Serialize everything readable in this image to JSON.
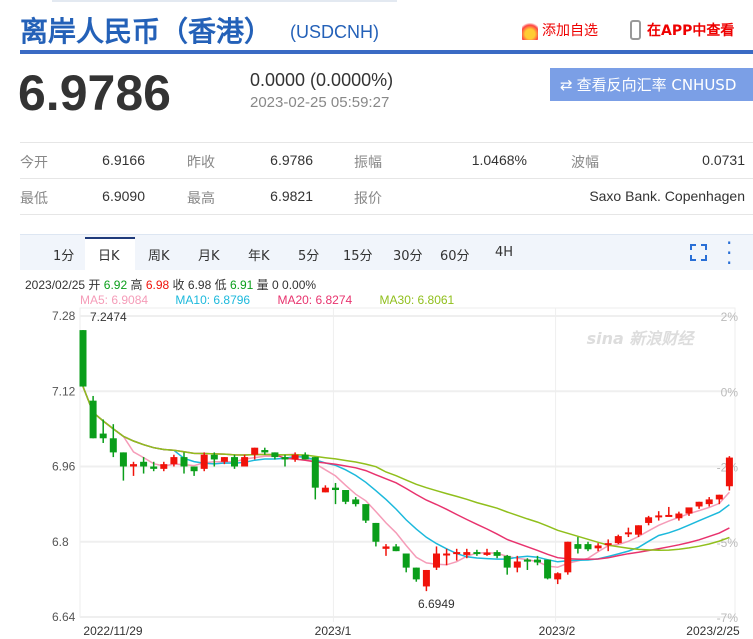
{
  "header": {
    "title": "离岸人民币（香港）",
    "code": "(USDCNH)",
    "add_watch": "添加自选",
    "view_in_app": "在APP中查看"
  },
  "quote": {
    "price": "6.9786",
    "change": "0.0000 (0.0000%)",
    "timestamp": "2023-02-25 05:59:27",
    "reverse_button": "查看反向汇率 CNHUSD"
  },
  "stats": [
    [
      {
        "label": "今开",
        "value": "6.9166"
      },
      {
        "label": "昨收",
        "value": "6.9786"
      },
      {
        "label": "振幅",
        "value": "1.0468%"
      },
      {
        "label": "波幅",
        "value": "0.0731"
      }
    ],
    [
      {
        "label": "最低",
        "value": "6.9090"
      },
      {
        "label": "最高",
        "value": "6.9821"
      },
      {
        "label": "报价",
        "value": ""
      },
      {
        "label": "",
        "value": "Saxo Bank. Copenhagen"
      }
    ]
  ],
  "tabs": [
    "1分",
    "日K",
    "周K",
    "月K",
    "年K",
    "5分",
    "15分",
    "30分",
    "60分",
    "4H"
  ],
  "active_tab": "日K",
  "ohlc_info": {
    "date": "2023/02/25",
    "open_label": "开",
    "open": "6.92",
    "high_label": "高",
    "high": "6.98",
    "close_label": "收",
    "close": "6.98",
    "low_label": "低",
    "low": "6.91",
    "vol_label": "量",
    "vol": "0 0.00%"
  },
  "ma_info": {
    "ma5": "MA5: 6.9084",
    "ma10": "MA10: 6.8796",
    "ma20": "MA20: 6.8274",
    "ma30": "MA30: 6.8061"
  },
  "colors": {
    "up": "#f0120a",
    "down": "#0a9e1a",
    "ma5": "#f59cb8",
    "ma10": "#1cb9dc",
    "ma20": "#e8336e",
    "ma30": "#90bf1c",
    "brand": "#2461b8"
  },
  "chart_data": {
    "type": "candlestick",
    "y_ticks": [
      "7.28",
      "7.12",
      "6.96",
      "6.8",
      "6.64"
    ],
    "y_tick_values": [
      7.28,
      7.12,
      6.96,
      6.8,
      6.64
    ],
    "pct_ticks": [
      "2%",
      "0%",
      "-2%",
      "-5%",
      "-7%"
    ],
    "pct_tick_values": [
      7.28,
      7.12,
      6.96,
      6.8,
      6.64
    ],
    "x_labels": [
      "2022/11/29",
      "2023/1",
      "2023/2",
      "2023/2/25"
    ],
    "x_label_index": [
      3,
      24,
      46,
      62
    ],
    "max_label": "7.2474",
    "min_label": "6.6949",
    "ylim": [
      6.64,
      7.28
    ],
    "ohlc": [
      [
        7.25,
        7.25,
        7.13,
        7.13
      ],
      [
        7.1,
        7.11,
        7.02,
        7.02
      ],
      [
        7.03,
        7.06,
        7.01,
        7.02
      ],
      [
        7.02,
        7.05,
        6.98,
        6.99
      ],
      [
        6.99,
        6.99,
        6.93,
        6.96
      ],
      [
        6.96,
        6.97,
        6.94,
        6.965
      ],
      [
        6.97,
        6.98,
        6.945,
        6.96
      ],
      [
        6.96,
        6.97,
        6.95,
        6.955
      ],
      [
        6.955,
        6.97,
        6.95,
        6.965
      ],
      [
        6.965,
        6.985,
        6.96,
        6.98
      ],
      [
        6.98,
        6.99,
        6.945,
        6.96
      ],
      [
        6.96,
        6.96,
        6.94,
        6.95
      ],
      [
        6.955,
        6.99,
        6.95,
        6.985
      ],
      [
        6.985,
        6.99,
        6.96,
        6.975
      ],
      [
        6.97,
        6.98,
        6.965,
        6.98
      ],
      [
        6.98,
        6.985,
        6.955,
        6.96
      ],
      [
        6.96,
        6.985,
        6.96,
        6.98
      ],
      [
        6.985,
        7.0,
        6.975,
        7.0
      ],
      [
        6.995,
        7.0,
        6.985,
        6.99
      ],
      [
        6.99,
        6.99,
        6.975,
        6.98
      ],
      [
        6.98,
        6.985,
        6.96,
        6.975
      ],
      [
        6.975,
        6.99,
        6.97,
        6.985
      ],
      [
        6.985,
        6.99,
        6.98,
        6.975
      ],
      [
        6.98,
        6.98,
        6.89,
        6.915
      ],
      [
        6.905,
        6.92,
        6.905,
        6.915
      ],
      [
        6.915,
        6.925,
        6.88,
        6.91
      ],
      [
        6.91,
        6.91,
        6.88,
        6.885
      ],
      [
        6.89,
        6.895,
        6.875,
        6.88
      ],
      [
        6.88,
        6.88,
        6.84,
        6.845
      ],
      [
        6.84,
        6.84,
        6.79,
        6.8
      ],
      [
        6.785,
        6.795,
        6.77,
        6.79
      ],
      [
        6.79,
        6.795,
        6.78,
        6.78
      ],
      [
        6.775,
        6.775,
        6.735,
        6.745
      ],
      [
        6.745,
        6.745,
        6.715,
        6.72
      ],
      [
        6.705,
        6.74,
        6.695,
        6.74
      ],
      [
        6.745,
        6.79,
        6.74,
        6.775
      ],
      [
        6.775,
        6.785,
        6.75,
        6.775
      ],
      [
        6.775,
        6.785,
        6.76,
        6.778
      ],
      [
        6.772,
        6.785,
        6.765,
        6.778
      ],
      [
        6.778,
        6.783,
        6.77,
        6.774
      ],
      [
        6.772,
        6.785,
        6.77,
        6.777
      ],
      [
        6.778,
        6.782,
        6.765,
        6.77
      ],
      [
        6.77,
        6.772,
        6.73,
        6.745
      ],
      [
        6.745,
        6.77,
        6.735,
        6.758
      ],
      [
        6.762,
        6.765,
        6.74,
        6.76
      ],
      [
        6.762,
        6.77,
        6.75,
        6.756
      ],
      [
        6.762,
        6.762,
        6.72,
        6.722
      ],
      [
        6.72,
        6.735,
        6.71,
        6.733
      ],
      [
        6.735,
        6.8,
        6.73,
        6.8
      ],
      [
        6.795,
        6.81,
        6.775,
        6.785
      ],
      [
        6.795,
        6.8,
        6.78,
        6.784
      ],
      [
        6.786,
        6.797,
        6.78,
        6.792
      ],
      [
        6.795,
        6.805,
        6.78,
        6.797
      ],
      [
        6.797,
        6.815,
        6.795,
        6.812
      ],
      [
        6.82,
        6.83,
        6.81,
        6.82
      ],
      [
        6.815,
        6.835,
        6.81,
        6.835
      ],
      [
        6.84,
        6.855,
        6.835,
        6.852
      ],
      [
        6.853,
        6.865,
        6.845,
        6.856
      ],
      [
        6.856,
        6.874,
        6.855,
        6.857
      ],
      [
        6.85,
        6.864,
        6.845,
        6.86
      ],
      [
        6.86,
        6.87,
        6.855,
        6.873
      ],
      [
        6.875,
        6.885,
        6.87,
        6.885
      ],
      [
        6.88,
        6.895,
        6.875,
        6.89
      ],
      [
        6.89,
        6.9,
        6.88,
        6.9
      ],
      [
        6.918,
        6.982,
        6.909,
        6.979
      ]
    ]
  }
}
